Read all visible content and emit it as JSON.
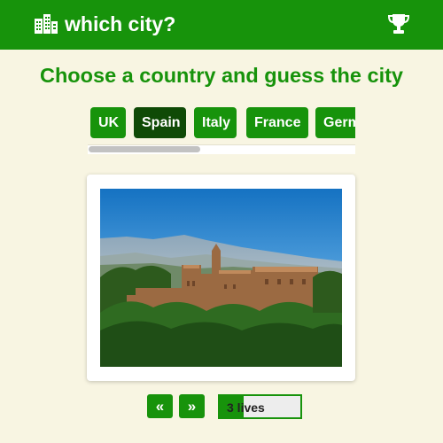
{
  "header": {
    "app_title": "which city?",
    "logo_icon": "city-buildings-icon",
    "trophy_icon": "trophy-icon"
  },
  "heading": "Choose a country and guess the city",
  "countries": [
    {
      "label": "UK",
      "active": false
    },
    {
      "label": "Spain",
      "active": true
    },
    {
      "label": "Italy",
      "active": false
    },
    {
      "label": "France",
      "active": false
    },
    {
      "label": "Germany",
      "active": false
    }
  ],
  "controls": {
    "prev_label": "«",
    "next_label": "»",
    "lives_text": "3 lives",
    "lives_fraction": 0.3
  },
  "colors": {
    "brand": "#17930b",
    "active_country": "#0f4a06",
    "background": "#f8f5e2"
  }
}
